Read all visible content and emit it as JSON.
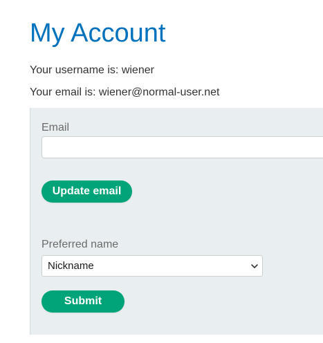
{
  "header": {
    "title": "My Account"
  },
  "account": {
    "username_text": "Your username is: wiener",
    "email_text": "Your email is: wiener@normal-user.net"
  },
  "email_form": {
    "label": "Email",
    "value": "",
    "placeholder": "",
    "button_label": "Update email"
  },
  "name_form": {
    "label": "Preferred name",
    "selected": "Nickname",
    "button_label": "Submit"
  },
  "icons": {
    "select_caret": "chevron-down-icon"
  },
  "colors": {
    "title": "#0071bc",
    "button": "#00a478",
    "panel": "#e9eef0"
  }
}
